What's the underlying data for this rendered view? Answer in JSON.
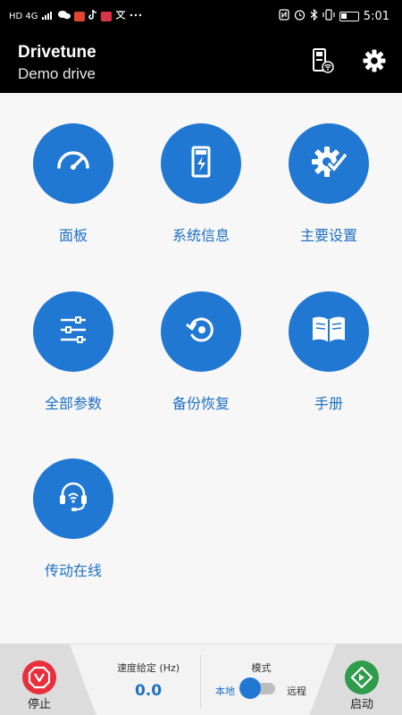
{
  "status_bar": {
    "left_text": "HD 4G",
    "time": "5:01"
  },
  "header": {
    "title": "Drivetune",
    "subtitle": "Demo drive",
    "drive_icon": "drive-wifi-icon",
    "settings_icon": "gear-icon"
  },
  "tiles": [
    {
      "label": "面板",
      "icon": "dashboard-gauge-icon"
    },
    {
      "label": "系统信息",
      "icon": "drive-device-icon"
    },
    {
      "label": "主要设置",
      "icon": "gear-check-icon"
    },
    {
      "label": "全部参数",
      "icon": "sliders-icon"
    },
    {
      "label": "备份恢复",
      "icon": "backup-restore-icon"
    },
    {
      "label": "手册",
      "icon": "book-icon"
    },
    {
      "label": "传动在线",
      "icon": "headset-support-icon"
    }
  ],
  "bottom": {
    "stop_label": "停止",
    "speed_title": "速度给定 (Hz)",
    "speed_value": "0.0",
    "mode_title": "模式",
    "mode_local": "本地",
    "mode_remote": "远程",
    "start_label": "启动"
  },
  "colors": {
    "accent": "#2178d3",
    "stop": "#e8303d",
    "start": "#2e9c4a",
    "header": "#000000"
  }
}
